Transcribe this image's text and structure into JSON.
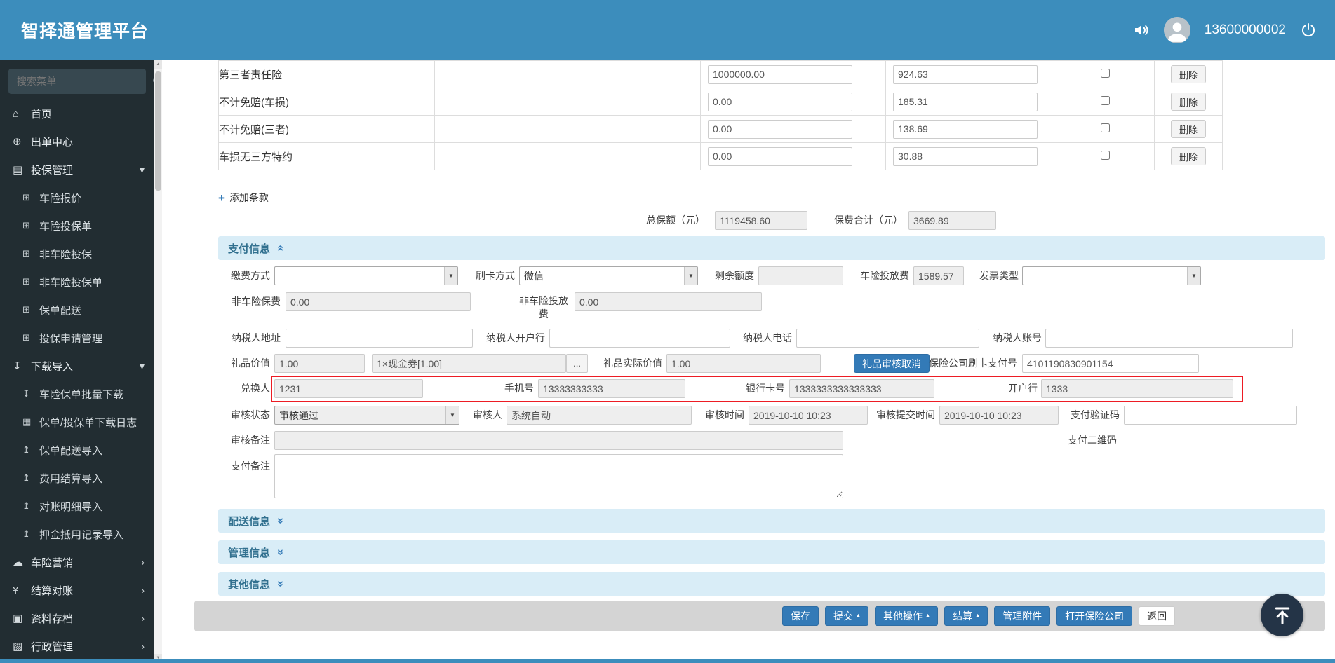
{
  "header": {
    "title": "智择通管理平台",
    "phone": "13600000002"
  },
  "sidebar": {
    "search_placeholder": "搜索菜单",
    "menu": [
      {
        "label": "首页"
      },
      {
        "label": "出单中心"
      },
      {
        "label": "投保管理"
      },
      {
        "label": "车险报价"
      },
      {
        "label": "车险投保单"
      },
      {
        "label": "非车险投保"
      },
      {
        "label": "非车险投保单"
      },
      {
        "label": "保单配送"
      },
      {
        "label": "投保申请管理"
      },
      {
        "label": "下载导入"
      },
      {
        "label": "车险保单批量下载"
      },
      {
        "label": "保单/投保单下载日志"
      },
      {
        "label": "保单配送导入"
      },
      {
        "label": "费用结算导入"
      },
      {
        "label": "对账明细导入"
      },
      {
        "label": "押金抵用记录导入"
      },
      {
        "label": "车险营销"
      },
      {
        "label": "结算对账"
      },
      {
        "label": "资料存档"
      },
      {
        "label": "行政管理"
      }
    ]
  },
  "clauses": {
    "rows": [
      {
        "name": "第三者责任险",
        "amount": "1000000.00",
        "premium": "924.63"
      },
      {
        "name": "不计免赔(车损)",
        "amount": "0.00",
        "premium": "185.31"
      },
      {
        "name": "不计免赔(三者)",
        "amount": "0.00",
        "premium": "138.69"
      },
      {
        "name": "车损无三方特约",
        "amount": "0.00",
        "premium": "30.88"
      }
    ],
    "delete_label": "删除",
    "add_label": "添加条款"
  },
  "totals": {
    "sum_insured_label": "总保额（元）",
    "sum_insured": "1119458.60",
    "premium_total_label": "保费合计（元）",
    "premium_total": "3669.89"
  },
  "sections": {
    "payment": "支付信息",
    "delivery": "配送信息",
    "management": "管理信息",
    "other": "其他信息"
  },
  "payment": {
    "pay_method_label": "缴费方式",
    "pay_method_value": "",
    "card_method_label": "刷卡方式",
    "card_method_value": "微信",
    "remaining_quota_label": "剩余额度",
    "remaining_quota_value": "",
    "auto_delivery_fee_label": "车险投放费",
    "auto_delivery_fee_value": "1589.57",
    "invoice_type_label": "发票类型",
    "invoice_type_value": "",
    "nonauto_premium_label": "非车险保费",
    "nonauto_premium_value": "0.00",
    "nonauto_delivery_fee_label": "非车险投放费",
    "nonauto_delivery_fee_value": "0.00",
    "taxpayer_address_label": "纳税人地址",
    "taxpayer_address_value": "",
    "taxpayer_bank_label": "纳税人开户行",
    "taxpayer_bank_value": "",
    "taxpayer_phone_label": "纳税人电话",
    "taxpayer_phone_value": "",
    "taxpayer_account_label": "纳税人账号",
    "taxpayer_account_value": "",
    "gift_value_label": "礼品价值",
    "gift_value": "1.00",
    "gift_item_value": "1×现金券[1.00]",
    "gift_more_label": "...",
    "gift_actual_label": "礼品实际价值",
    "gift_actual_value": "1.00",
    "gift_cancel_label": "礼品审核取消",
    "insurer_card_pay_no_label": "保险公司刷卡支付号",
    "insurer_card_pay_no_value": "4101190830901154",
    "redeemer_label": "兑换人",
    "redeemer_value": "1231",
    "mobile_label": "手机号",
    "mobile_value": "13333333333",
    "bank_card_label": "银行卡号",
    "bank_card_value": "1333333333333333",
    "bank_label": "开户行",
    "bank_value": "1333",
    "audit_status_label": "审核状态",
    "audit_status_value": "审核通过",
    "auditor_label": "审核人",
    "auditor_value": "系统自动",
    "audit_time_label": "审核时间",
    "audit_time_value": "2019-10-10 10:23",
    "audit_submit_time_label": "审核提交时间",
    "audit_submit_time_value": "2019-10-10 10:23",
    "pay_code_label": "支付验证码",
    "pay_code_value": "",
    "audit_remark_label": "审核备注",
    "audit_remark_value": "",
    "pay_qrcode_label": "支付二维码",
    "pay_remark_label": "支付备注",
    "pay_remark_value": ""
  },
  "footer": {
    "save": "保存",
    "submit": "提交",
    "other_ops": "其他操作",
    "settle": "结算",
    "attachments": "管理附件",
    "open_insurer": "打开保险公司",
    "back": "返回"
  },
  "icons": {
    "home": "⌂",
    "globe": "⊕",
    "file": "▤",
    "grid": "⊞",
    "download": "↧",
    "book": "▦",
    "import": "↥",
    "cloud": "☁",
    "yen": "¥",
    "archive": "▣",
    "brief": "▨",
    "chev_down": "▾",
    "chev_right": "›",
    "select_arrow": "▼",
    "caret_up": "▴",
    "plus": "+",
    "collapse": "«",
    "scroll_up": "▲",
    "scroll_down": "▼"
  }
}
